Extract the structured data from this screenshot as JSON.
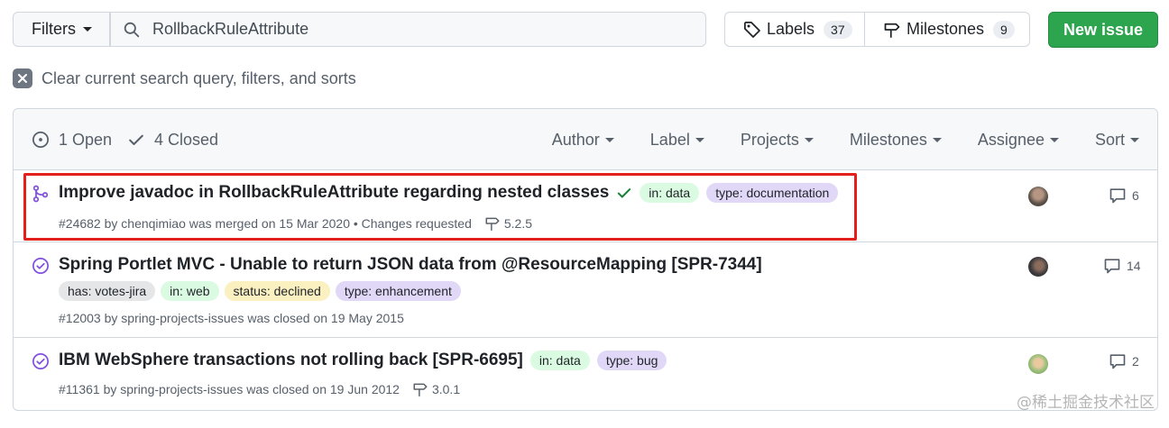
{
  "topbar": {
    "filters_label": "Filters",
    "search_value": "RollbackRuleAttribute",
    "labels_label": "Labels",
    "labels_count": "37",
    "milestones_label": "Milestones",
    "milestones_count": "9",
    "new_issue_label": "New issue"
  },
  "clear": {
    "label": "Clear current search query, filters, and sorts"
  },
  "header": {
    "open_label": "1 Open",
    "closed_label": "4 Closed",
    "filters": [
      "Author",
      "Label",
      "Projects",
      "Milestones",
      "Assignee",
      "Sort"
    ]
  },
  "issues": [
    {
      "title": "Improve javadoc in RollbackRuleAttribute regarding nested classes",
      "status_icon": "merged-pr-icon",
      "labels": [
        {
          "text": "in: data"
        },
        {
          "text": "type: documentation"
        }
      ],
      "meta": "#24682 by chenqimiao was merged on 15 Mar 2020 • Changes requested",
      "milestone": "5.2.5",
      "comments": "6"
    },
    {
      "title": "Spring Portlet MVC - Unable to return JSON data from @ResourceMapping [SPR-7344]",
      "status_icon": "closed-issue-icon",
      "labels": [
        {
          "text": "has: votes-jira"
        },
        {
          "text": "in: web"
        },
        {
          "text": "status: declined"
        },
        {
          "text": "type: enhancement"
        }
      ],
      "meta": "#12003 by spring-projects-issues was closed on 19 May 2015",
      "comments": "14"
    },
    {
      "title": "IBM WebSphere transactions not rolling back [SPR-6695]",
      "status_icon": "closed-issue-icon",
      "labels": [
        {
          "text": "in: data"
        },
        {
          "text": "type: bug"
        }
      ],
      "meta": "#11361 by spring-projects-issues was closed on 19 Jun 2012",
      "milestone": "3.0.1",
      "comments": "2"
    }
  ],
  "colors": {
    "primary_button": "#2da44e",
    "merged": "#8250df",
    "highlight_box": "#e3201b"
  },
  "watermark": "@稀土掘金技术社区"
}
